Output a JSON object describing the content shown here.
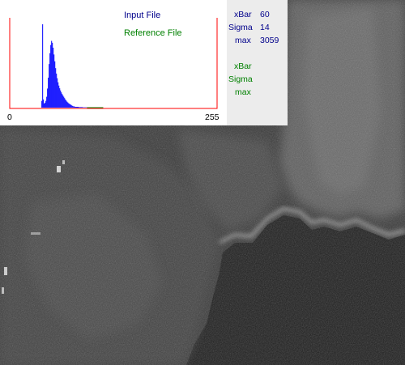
{
  "colors": {
    "input": "#00008b",
    "reference": "#008000",
    "histogram_fill": "#0000ff",
    "histogram_frame": "#ff0000"
  },
  "legend": {
    "input_label": "Input File",
    "reference_label": "Reference File"
  },
  "input_stats": {
    "xbar_label": "xBar",
    "xbar_value": "60",
    "sigma_label": "Sigma",
    "sigma_value": "14",
    "max_label": "max",
    "max_value": "3059"
  },
  "reference_stats": {
    "xbar_label": "xBar",
    "sigma_label": "Sigma",
    "max_label": "max"
  },
  "chart_data": {
    "type": "area",
    "xlim": [
      0,
      255
    ],
    "ylim": [
      0,
      3059
    ],
    "x_ticks": [
      "0",
      "255"
    ],
    "series": [
      {
        "name": "Input File",
        "color": "#0000ff",
        "x": [
          38,
          39,
          40,
          41,
          42,
          43,
          44,
          45,
          46,
          47,
          48,
          49,
          50,
          51,
          52,
          53,
          54,
          55,
          56,
          57,
          58,
          59,
          60,
          61,
          62,
          63,
          64,
          65,
          66,
          67,
          68,
          69,
          70,
          71,
          72,
          73,
          74,
          75,
          76,
          77,
          78,
          80,
          85,
          90,
          95,
          100,
          105
        ],
        "values": [
          0,
          250,
          3059,
          300,
          150,
          180,
          250,
          400,
          700,
          1100,
          1600,
          2000,
          2300,
          2450,
          2380,
          2200,
          1950,
          1700,
          1450,
          1250,
          1080,
          930,
          810,
          710,
          630,
          560,
          500,
          450,
          400,
          350,
          300,
          260,
          220,
          190,
          160,
          140,
          120,
          100,
          80,
          60,
          45,
          30,
          20,
          12,
          8,
          4,
          0
        ]
      }
    ]
  }
}
